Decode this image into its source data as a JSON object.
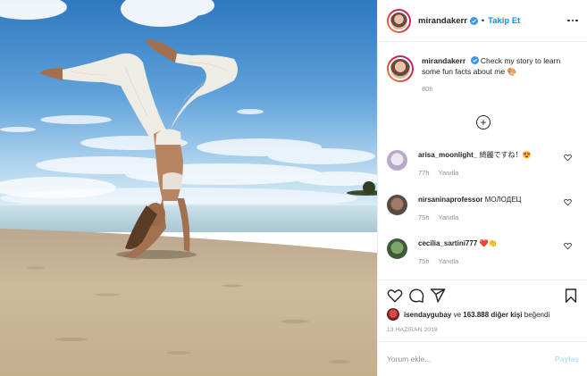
{
  "header": {
    "username": "mirandakerr",
    "separator": "•",
    "follow_label": "Takip Et"
  },
  "caption": {
    "username": "mirandakerr",
    "text": "Check my story to learn some fun facts about me",
    "emoji": "🎨",
    "age": "80h"
  },
  "comments": [
    {
      "username": "arisa_moonlight_",
      "text": "綺麗ですね！😍",
      "age": "77h",
      "reply_label": "Yanıtla"
    },
    {
      "username": "nirsaninaprofessor",
      "text": "МОЛОДЕЦ",
      "age": "75h",
      "reply_label": "Yanıtla"
    },
    {
      "username": "cecilia_sartini777",
      "text": "❤️👏",
      "age": "75h",
      "reply_label": "Yanıtla"
    }
  ],
  "likes": {
    "first_liker": "isendaygubay",
    "connector": " ve ",
    "others": "163.888 diğer kişi",
    "suffix": " beğendi"
  },
  "date": "13 HAZİRAN 2018",
  "composer": {
    "placeholder": "Yorum ekle...",
    "share_label": "Paylaş"
  },
  "icons": {
    "verified": "verified-badge-icon",
    "more": "more-options-icon",
    "load_more": "plus-circle-icon",
    "like": "heart-icon",
    "comment": "comment-icon",
    "share": "paper-plane-icon",
    "save": "bookmark-icon"
  },
  "colors": {
    "accent": "#0095f6",
    "disabled_accent": "#b2dffc",
    "muted": "#8e8e8e",
    "text": "#262626"
  }
}
